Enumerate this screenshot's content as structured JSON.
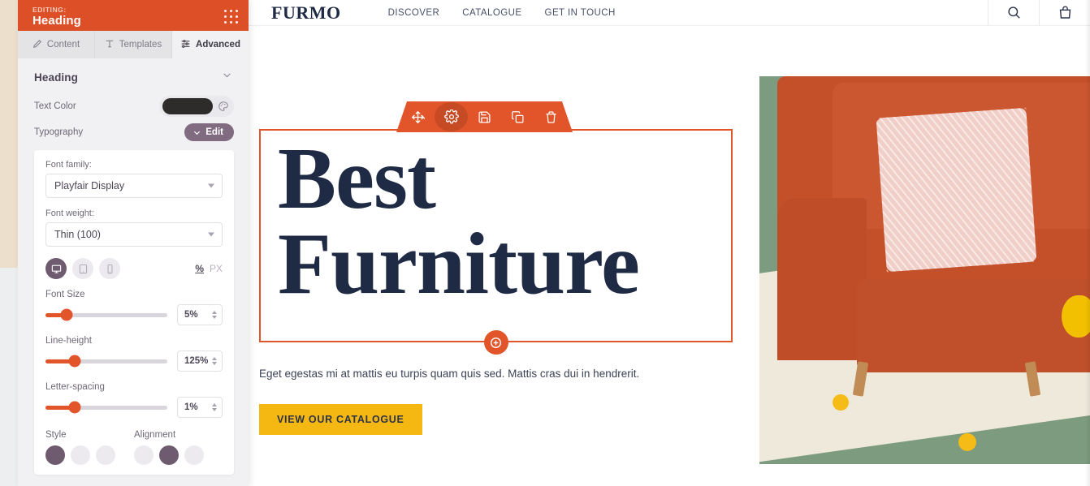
{
  "sidebar": {
    "editing_label": "EDITING:",
    "element_name": "Heading",
    "drag_handle_icon": "grid-dots-icon",
    "tabs": [
      {
        "label": "Content",
        "icon": "pencil-icon",
        "active": false
      },
      {
        "label": "Templates",
        "icon": "template-icon",
        "active": false
      },
      {
        "label": "Advanced",
        "icon": "sliders-icon",
        "active": true
      }
    ],
    "panel": {
      "title": "Heading",
      "collapse_icon": "chevron-down-icon",
      "text_color_label": "Text Color",
      "text_color_value": "#2e2c2b",
      "palette_icon": "palette-icon",
      "typography_label": "Typography",
      "typography_edit_button": "Edit",
      "typography": {
        "font_family_label": "Font family:",
        "font_family_value": "Playfair Display",
        "font_weight_label": "Font weight:",
        "font_weight_value": "Thin (100)",
        "devices": [
          {
            "name": "desktop-icon",
            "active": true
          },
          {
            "name": "tablet-icon",
            "active": false
          },
          {
            "name": "mobile-icon",
            "active": false
          }
        ],
        "unit_percent": "%",
        "unit_px": "PX",
        "unit_active": "%",
        "sliders": [
          {
            "label": "Font Size",
            "value": "5%",
            "fill_pct": 17
          },
          {
            "label": "Line-height",
            "value": "125%",
            "fill_pct": 24
          },
          {
            "label": "Letter-spacing",
            "value": "1%",
            "fill_pct": 24
          }
        ],
        "style_label": "Style",
        "alignment_label": "Alignment"
      }
    }
  },
  "site": {
    "brand": "FURMO",
    "nav_links": [
      "DISCOVER",
      "CATALOGUE",
      "GET IN TOUCH"
    ],
    "search_icon": "search-icon",
    "cart_icon": "shopping-bag-icon",
    "hero": {
      "heading_line1": "Best",
      "heading_line2": "Furniture",
      "subtext": "Eget egestas mi at mattis eu turpis quam quis sed. Mattis cras dui in hendrerit.",
      "cta_label": "VIEW OUR CATALOGUE",
      "photo_alt": "orange sofa with pink quilted pillow on cream rug"
    },
    "element_toolbar": [
      {
        "name": "move-icon",
        "label": "Move",
        "active": false
      },
      {
        "name": "gear-icon",
        "label": "Settings",
        "active": true
      },
      {
        "name": "save-icon",
        "label": "Save",
        "active": false
      },
      {
        "name": "duplicate-icon",
        "label": "Duplicate",
        "active": false
      },
      {
        "name": "trash-icon",
        "label": "Delete",
        "active": false
      }
    ],
    "add_element_icon": "plus-circle-icon"
  },
  "colors": {
    "accent_orange": "#e2552a",
    "header_orange": "#dd4f26",
    "purple": "#806b80",
    "heading_navy": "#1f2a44",
    "cta_yellow": "#f5b712"
  }
}
